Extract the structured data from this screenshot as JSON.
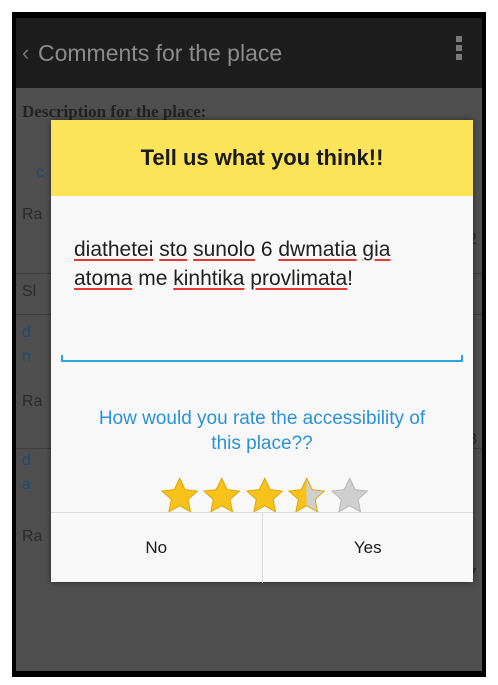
{
  "actionbar": {
    "title": "Comments for the place"
  },
  "background": {
    "heading": "Description for the place:",
    "frag_c": "c",
    "frag_ra1": "Ra",
    "frag_num1": "2",
    "frag_si": "Sl",
    "frag_d1": "d",
    "frag_n": "n",
    "frag_ra2": "Ra",
    "frag_num2": "8",
    "frag_d2": "d",
    "frag_a": "a",
    "frag_ra3": "Ra",
    "frag_num3": "7"
  },
  "dialog": {
    "title": "Tell us what you think!!",
    "comment_words": [
      "diathetei",
      "sto",
      "sunolo",
      "6",
      "dwmatia",
      "gia",
      "atoma",
      "me",
      "kinhtika",
      "provlimata",
      "!"
    ],
    "question": "How would you rate the accessibility of this place??",
    "rating": 3.5,
    "rating_max": 5,
    "no_label": "No",
    "yes_label": "Yes"
  },
  "colors": {
    "header": "#fbe45a",
    "accent_blue": "#2a92d6",
    "input_line": "#33a3dc",
    "star_fill": "#f7c21a",
    "star_empty": "#cfcfcf"
  }
}
